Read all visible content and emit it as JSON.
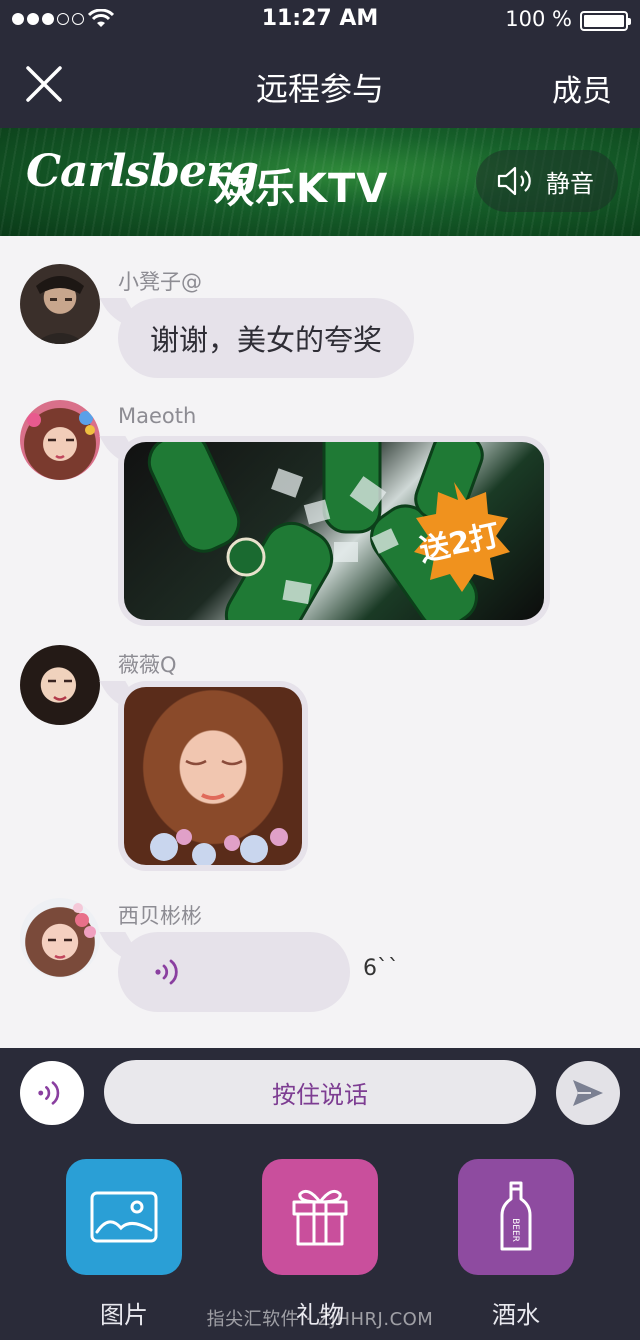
{
  "status_bar": {
    "time": "11:27 AM",
    "battery": "100 %"
  },
  "nav": {
    "title": "远程参与",
    "right_label": "成员"
  },
  "banner": {
    "brand": "Carlsberg",
    "brand_sub": "欢乐KTV",
    "mute_label": "静音"
  },
  "messages": [
    {
      "user": "小凳子@",
      "text": "谢谢，美女的夸奖"
    },
    {
      "user": "Maeoth",
      "badge": "送2打"
    },
    {
      "user": "薇薇Q"
    },
    {
      "user": "西贝彬彬",
      "duration": "6``"
    }
  ],
  "input": {
    "hold_to_talk": "按住说话"
  },
  "toolbar": {
    "items": [
      {
        "label": "图片",
        "color": "#2a9fd6"
      },
      {
        "label": "礼物",
        "color": "#c94f9c"
      },
      {
        "label": "酒水",
        "color": "#8e4ba0"
      }
    ],
    "bottle_text": "BEER"
  },
  "watermark": "指尖汇软件 · ZJHHRJ.COM",
  "colors": {
    "bar": "#2a2b39",
    "accent": "#7d3d92",
    "bubble": "#e6e2ea"
  }
}
